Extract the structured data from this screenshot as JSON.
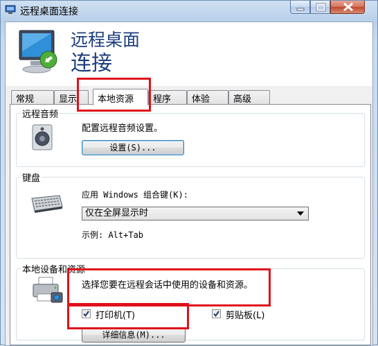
{
  "window": {
    "title": "远程桌面连接"
  },
  "header": {
    "line1": "远程桌面",
    "line2": "连接"
  },
  "tabs": [
    {
      "label": "常规",
      "active": false
    },
    {
      "label": "显示",
      "active": false
    },
    {
      "label": "本地资源",
      "active": true
    },
    {
      "label": "程序",
      "active": false
    },
    {
      "label": "体验",
      "active": false
    },
    {
      "label": "高级",
      "active": false
    }
  ],
  "audio": {
    "group_title": "远程音频",
    "description": "配置远程音频设置。",
    "settings_button": "设置(S)..."
  },
  "keyboard": {
    "group_title": "键盘",
    "apply_label": "应用 Windows 组合键(K):",
    "selected_option": "仅在全屏显示时",
    "example": "示例: Alt+Tab"
  },
  "devices": {
    "group_title": "本地设备和资源",
    "description": "选择您要在远程会话中使用的设备和资源。",
    "printers_label": "打印机(T)",
    "printers_checked": true,
    "clipboard_label": "剪贴板(L)",
    "clipboard_checked": true,
    "details_button": "详细信息(M)..."
  },
  "colors": {
    "highlight": "#e0101a",
    "header_text": "#1c3e7c"
  },
  "icons": [
    "app-icon",
    "remote-desktop-monitor-icon",
    "speaker-icon",
    "keyboard-icon",
    "printer-icon",
    "dropdown-arrow-icon",
    "checkmark-icon"
  ]
}
